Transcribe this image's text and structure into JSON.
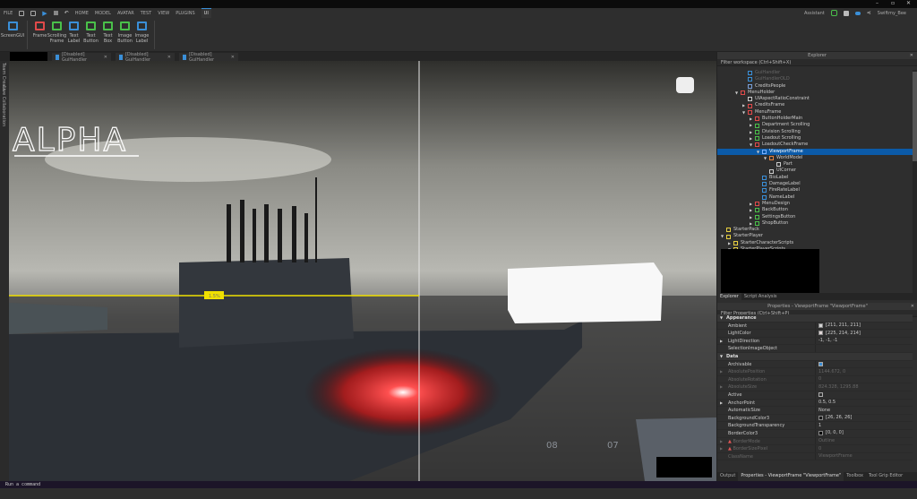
{
  "menu": {
    "file": "FILE",
    "tabs": [
      "HOME",
      "MODEL",
      "AVATAR",
      "TEST",
      "VIEW",
      "PLUGINS",
      "UI"
    ],
    "active": "UI"
  },
  "ribbon": [
    {
      "label": "ScreenGUI",
      "color": "#3a8fd8"
    },
    {
      "label": "Frame",
      "color": "#e04a4a"
    },
    {
      "label": "Scrolling Frame",
      "color": "#4ac04a"
    },
    {
      "label": "Text Label",
      "color": "#3a8fd8"
    },
    {
      "label": "Text Button",
      "color": "#4ac04a"
    },
    {
      "label": "Text Box",
      "color": "#4ac04a"
    },
    {
      "label": "Image Button",
      "color": "#4ac04a"
    },
    {
      "label": "Image Label",
      "color": "#3a8fd8"
    }
  ],
  "topright": {
    "assistant": "Assistant",
    "user": "Swiftmy_Bee"
  },
  "doc_tabs": [
    "[Disabled] GuiHandler",
    "[Disabled] GuiHandler",
    "[Disabled] GuiHandler"
  ],
  "left_tabs": [
    "Team Create",
    "Live Collaboration"
  ],
  "viewport": {
    "logo": "ALPHA",
    "marker": "1.5%",
    "hull_numbers": [
      "08",
      "07"
    ]
  },
  "explorer": {
    "title": "Explorer",
    "filter": "Filter workspace (Ctrl+Shift+X)",
    "items": [
      {
        "label": "GuiHandler",
        "lvl": 3,
        "icon": "#3a8fd8",
        "dis": true
      },
      {
        "label": "GuiHandlerOLD",
        "lvl": 3,
        "icon": "#3a8fd8",
        "dis": true
      },
      {
        "label": "CreditsPeople",
        "lvl": 3,
        "icon": "#7aa0d8"
      },
      {
        "label": "MenuHolder",
        "lvl": 2,
        "icon": "#e04a4a",
        "ar": "open"
      },
      {
        "label": "UIAspectRatioConstraint",
        "lvl": 3,
        "icon": "#ccc"
      },
      {
        "label": "CreditsFrame",
        "lvl": 3,
        "icon": "#e04a4a",
        "ar": "closed"
      },
      {
        "label": "MenuFrame",
        "lvl": 3,
        "icon": "#e04a4a",
        "ar": "open"
      },
      {
        "label": "ButtonHolderMain",
        "lvl": 4,
        "icon": "#e04a4a",
        "ar": "closed"
      },
      {
        "label": "Department Scrolling",
        "lvl": 4,
        "icon": "#4ac04a",
        "ar": "closed"
      },
      {
        "label": "Division Scrolling",
        "lvl": 4,
        "icon": "#4ac04a",
        "ar": "closed"
      },
      {
        "label": "Loadout Scrolling",
        "lvl": 4,
        "icon": "#4ac04a",
        "ar": "closed"
      },
      {
        "label": "LoadoutCheckFrame",
        "lvl": 4,
        "icon": "#e04a4a",
        "ar": "open"
      },
      {
        "label": "ViewportFrame",
        "lvl": 5,
        "icon": "#7ab0ff",
        "ar": "open",
        "sel": true
      },
      {
        "label": "WorldModel",
        "lvl": 6,
        "icon": "#e08040",
        "ar": "open"
      },
      {
        "label": "Part",
        "lvl": 7,
        "icon": "#ccc"
      },
      {
        "label": "UICorner",
        "lvl": 6,
        "icon": "#ccc"
      },
      {
        "label": "BioLabel",
        "lvl": 5,
        "icon": "#3a8fd8"
      },
      {
        "label": "DamageLabel",
        "lvl": 5,
        "icon": "#3a8fd8"
      },
      {
        "label": "FireRateLabel",
        "lvl": 5,
        "icon": "#3a8fd8"
      },
      {
        "label": "NameLabel",
        "lvl": 5,
        "icon": "#3a8fd8"
      },
      {
        "label": "MenuDesign",
        "lvl": 4,
        "icon": "#e04a4a",
        "ar": "closed"
      },
      {
        "label": "BackButton",
        "lvl": 4,
        "icon": "#4ac04a",
        "ar": "closed"
      },
      {
        "label": "SettingsButton",
        "lvl": 4,
        "icon": "#4ac04a",
        "ar": "closed"
      },
      {
        "label": "ShopButton",
        "lvl": 4,
        "icon": "#4ac04a",
        "ar": "closed"
      },
      {
        "label": "StarterPack",
        "lvl": 0,
        "icon": "#e8d040"
      },
      {
        "label": "StarterPlayer",
        "lvl": 0,
        "icon": "#e8d040",
        "ar": "open"
      },
      {
        "label": "StarterCharacterScripts",
        "lvl": 1,
        "icon": "#e8d040",
        "ar": "closed"
      },
      {
        "label": "StarterPlayerScripts",
        "lvl": 1,
        "icon": "#e8d040",
        "ar": "open"
      }
    ],
    "tabs": [
      "Explorer",
      "Script Analysis"
    ]
  },
  "properties": {
    "title": "Properties - ViewportFrame \"ViewportFrame\"",
    "filter": "Filter Properties (Ctrl+Shift+P)",
    "rows": [
      {
        "name": "Appearance",
        "sec": true
      },
      {
        "name": "Ambient",
        "value": "[211, 211, 211]",
        "swatch": "#d3d3d3"
      },
      {
        "name": "LightColor",
        "value": "[225, 214, 214]",
        "swatch": "#e1d6d6"
      },
      {
        "name": "LightDirection",
        "value": "-1, -1, -1",
        "ex": true
      },
      {
        "name": "SelectionImageObject",
        "value": ""
      },
      {
        "name": "Data",
        "sec": true
      },
      {
        "name": "Archivable",
        "check": true
      },
      {
        "name": "AbsolutePosition",
        "value": "1144.672, 0",
        "ro": true,
        "ex": true
      },
      {
        "name": "AbsoluteRotation",
        "value": "0",
        "ro": true
      },
      {
        "name": "AbsoluteSize",
        "value": "824.328, 1295.88",
        "ro": true,
        "ex": true
      },
      {
        "name": "Active",
        "check": false
      },
      {
        "name": "AnchorPoint",
        "value": "0.5, 0.5",
        "ex": true
      },
      {
        "name": "AutomaticSize",
        "value": "None"
      },
      {
        "name": "BackgroundColor3",
        "value": "[26, 26, 26]",
        "swatch": "#1a1a1a"
      },
      {
        "name": "BackgroundTransparency",
        "value": "1"
      },
      {
        "name": "BorderColor3",
        "value": "[0, 0, 0]",
        "swatch": "#000000"
      },
      {
        "name": "BorderMode",
        "value": "Outline",
        "ro": true,
        "warn": true,
        "ex": true
      },
      {
        "name": "BorderSizePixel",
        "value": "0",
        "ro": true,
        "warn": true,
        "ex": true
      },
      {
        "name": "ClassName",
        "value": "ViewportFrame",
        "ro": true
      }
    ],
    "tabs": [
      "Output",
      "Properties - ViewportFrame \"ViewportFrame\"",
      "Toolbox",
      "Tool Grip Editor"
    ]
  },
  "command": {
    "placeholder": "Run a command"
  }
}
